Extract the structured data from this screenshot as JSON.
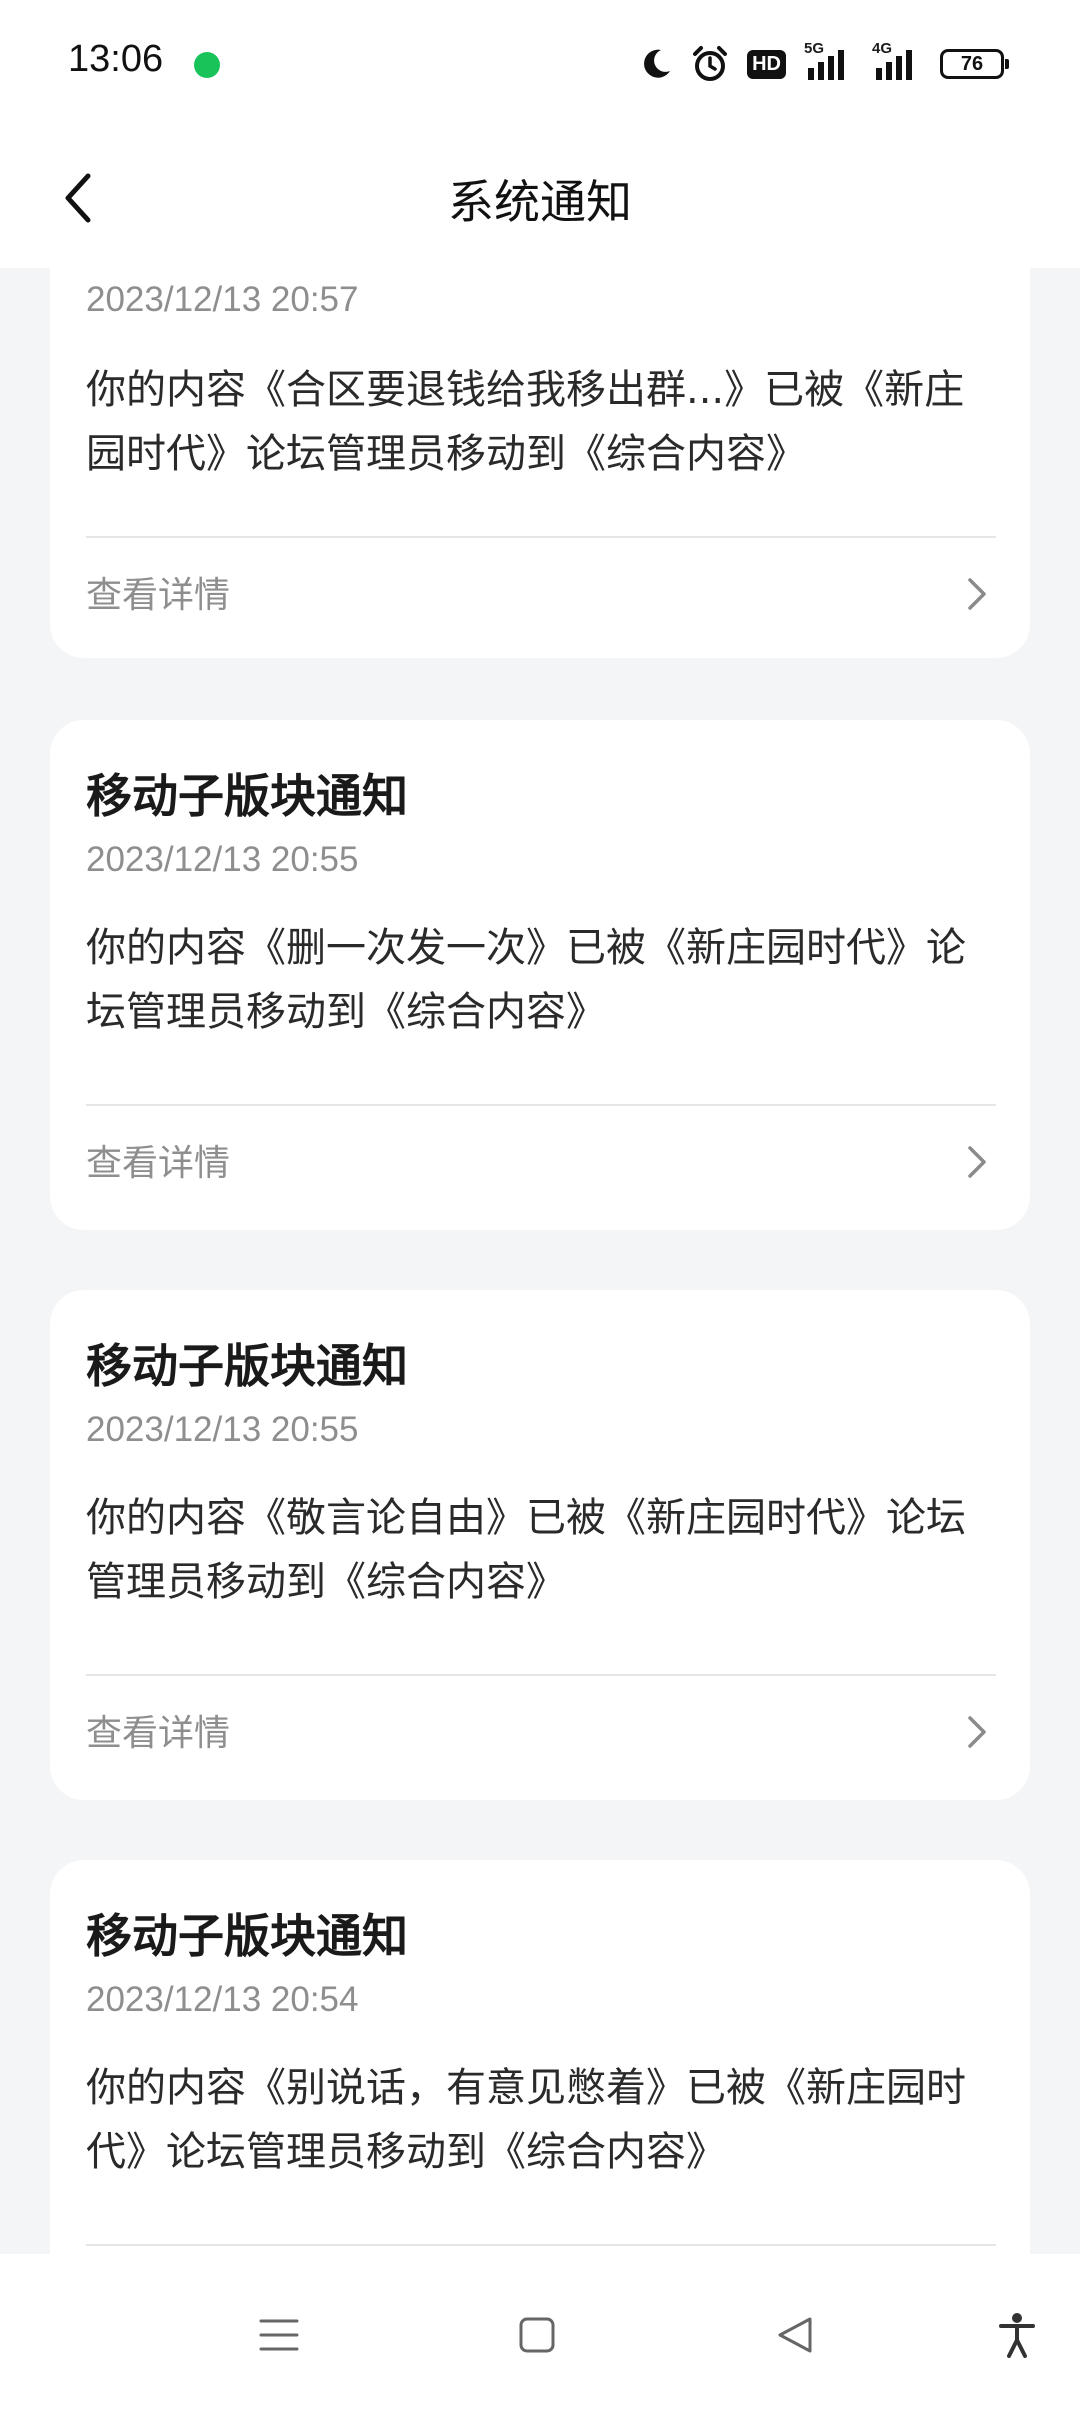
{
  "status_bar": {
    "time": "13:06",
    "icons": [
      "moon-icon",
      "alarm-icon",
      "hd-icon",
      "signal-5g-icon",
      "signal-4g-icon"
    ],
    "hd_label": "HD",
    "net1_label": "5G",
    "net2_label": "4G",
    "battery": "76",
    "colors": {
      "notification_dot": "#18c35a"
    }
  },
  "header": {
    "title": "系统通知"
  },
  "cards": [
    {
      "time": "2023/12/13 20:57",
      "body": "你的内容《合区要退钱给我移出群...》已被《新庄园时代》论坛管理员移动到《综合内容》",
      "detail": "查看详情"
    },
    {
      "title": "移动子版块通知",
      "time": "2023/12/13 20:55",
      "body": "你的内容《删一次发一次》已被《新庄园时代》论坛管理员移动到《综合内容》",
      "detail": "查看详情"
    },
    {
      "title": "移动子版块通知",
      "time": "2023/12/13 20:55",
      "body": "你的内容《敬言论自由》已被《新庄园时代》论坛管理员移动到《综合内容》",
      "detail": "查看详情"
    },
    {
      "title": "移动子版块通知",
      "time": "2023/12/13 20:54",
      "body": "你的内容《别说话，有意见憋着》已被《新庄园时代》论坛管理员移动到《综合内容》"
    }
  ],
  "nav_bar": {
    "icons": [
      "menu-icon",
      "home-icon",
      "back-triangle-icon",
      "accessibility-icon"
    ]
  }
}
